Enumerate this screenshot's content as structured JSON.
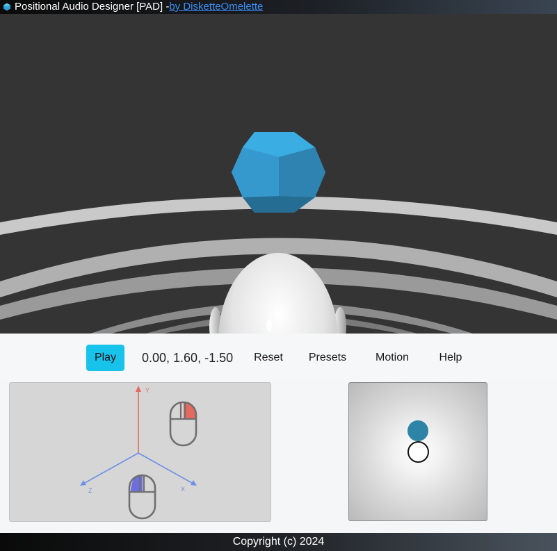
{
  "window": {
    "title": "Positional Audio Designer [PAD] - ",
    "author_link": "by DisketteOmelette",
    "icon": "dodecahedron-app-icon"
  },
  "toolbar": {
    "play_label": "Play",
    "position_readout": "0.00, 1.60, -1.50",
    "reset_label": "Reset",
    "presets_label": "Presets",
    "motion_label": "Motion",
    "help_label": "Help",
    "accent_color": "#18c3eb"
  },
  "axis_help": {
    "y_label": "Y",
    "x_label": "X",
    "z_label": "Z",
    "y_color": "#e46a60",
    "xz_color": "#6d8fe6",
    "right_mouse_icon": "mouse-right-button-icon",
    "left_mouse_icon": "mouse-left-button-icon"
  },
  "orbit_map": {
    "source_color": "#2d84a6",
    "listener_color": "#ffffff"
  },
  "footer": {
    "copyright": "Copyright (c) 2024"
  }
}
